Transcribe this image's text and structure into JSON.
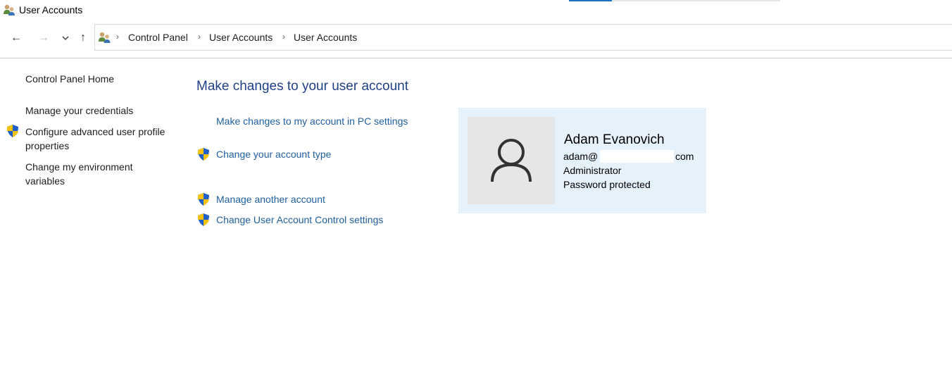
{
  "window": {
    "title": "User Accounts",
    "icon": "user-accounts-icon"
  },
  "nav": {
    "back_icon": "arrow-left-icon",
    "forward_icon": "arrow-right-icon",
    "recent_icon": "chevron-down-icon",
    "up_icon": "arrow-up-icon",
    "back_glyph": "←",
    "forward_glyph": "→",
    "recent_glyph": "⌄",
    "up_glyph": "↑"
  },
  "breadcrumb": {
    "icon": "user-accounts-icon",
    "separator": "›",
    "items": [
      "Control Panel",
      "User Accounts",
      "User Accounts"
    ]
  },
  "sidebar": {
    "items": [
      {
        "label": "Control Panel Home",
        "shield": false
      },
      {
        "label": "Manage your credentials",
        "shield": false
      },
      {
        "label": "Configure advanced user profile properties",
        "shield": true
      },
      {
        "label": "Change my environment variables",
        "shield": false
      }
    ]
  },
  "main": {
    "heading": "Make changes to your user account",
    "tasks": [
      {
        "label": "Make changes to my account in PC settings",
        "shield": false
      },
      {
        "label": "Change your account type",
        "shield": true
      },
      {
        "label": "Manage another account",
        "shield": true
      },
      {
        "label": "Change User Account Control settings",
        "shield": true
      }
    ]
  },
  "account": {
    "name": "Adam Evanovich",
    "email_prefix": "adam@",
    "email_suffix": "com",
    "role": "Administrator",
    "status": "Password protected",
    "avatar_icon": "user-silhouette-icon"
  },
  "colors": {
    "link": "#1f5fa0",
    "heading": "#1f3f86",
    "card_background": "#e5f1fb",
    "shield_blue": "#1f5fc8",
    "shield_yellow": "#f4c20d"
  }
}
